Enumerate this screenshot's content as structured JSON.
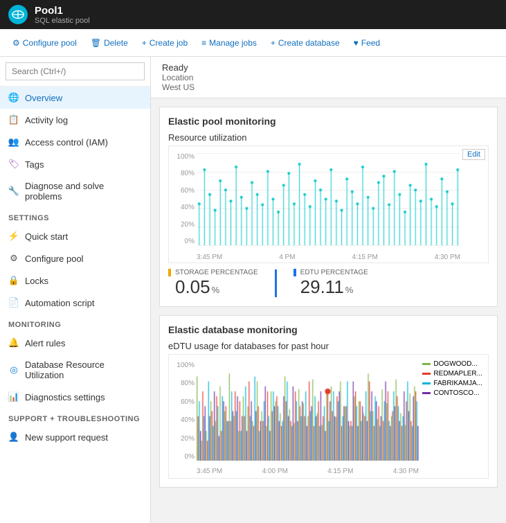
{
  "header": {
    "title": "Pool1",
    "subtitle": "SQL elastic pool",
    "icon_color": "#00b4d8"
  },
  "toolbar": {
    "buttons": [
      {
        "id": "configure-pool",
        "label": "Configure pool",
        "icon": "⚙"
      },
      {
        "id": "delete",
        "label": "Delete",
        "icon": "🗑"
      },
      {
        "id": "create-job",
        "label": "Create job",
        "icon": "+"
      },
      {
        "id": "manage-jobs",
        "label": "Manage jobs",
        "icon": "≡"
      },
      {
        "id": "create-database",
        "label": "Create database",
        "icon": "+"
      },
      {
        "id": "feed",
        "label": "Feed",
        "icon": "♥"
      }
    ]
  },
  "search": {
    "placeholder": "Search (Ctrl+/)"
  },
  "sidebar": {
    "nav_items": [
      {
        "id": "overview",
        "label": "Overview",
        "icon": "globe",
        "active": true
      },
      {
        "id": "activity-log",
        "label": "Activity log",
        "icon": "list"
      },
      {
        "id": "access-control",
        "label": "Access control (IAM)",
        "icon": "people"
      },
      {
        "id": "tags",
        "label": "Tags",
        "icon": "tag"
      },
      {
        "id": "diagnose",
        "label": "Diagnose and solve problems",
        "icon": "wrench"
      }
    ],
    "sections": [
      {
        "title": "SETTINGS",
        "items": [
          {
            "id": "quick-start",
            "label": "Quick start",
            "icon": "lightning"
          },
          {
            "id": "configure-pool",
            "label": "Configure pool",
            "icon": "gear"
          },
          {
            "id": "locks",
            "label": "Locks",
            "icon": "lock"
          },
          {
            "id": "automation-script",
            "label": "Automation script",
            "icon": "script"
          }
        ]
      },
      {
        "title": "MONITORING",
        "items": [
          {
            "id": "alert-rules",
            "label": "Alert rules",
            "icon": "alert"
          },
          {
            "id": "db-resource",
            "label": "Database Resource Utilization",
            "icon": "circle"
          },
          {
            "id": "diagnostics",
            "label": "Diagnostics settings",
            "icon": "chart"
          }
        ]
      },
      {
        "title": "SUPPORT + TROUBLESHOOTING",
        "items": [
          {
            "id": "new-support",
            "label": "New support request",
            "icon": "person"
          }
        ]
      }
    ]
  },
  "content": {
    "status": "Ready",
    "location_label": "Location",
    "location_value": "West US",
    "pool_monitoring": {
      "title": "Elastic pool monitoring",
      "chart_title": "Resource utilization",
      "edit_label": "Edit",
      "x_labels": [
        "3:45 PM",
        "4 PM",
        "4:15 PM",
        "4:30 PM"
      ],
      "y_labels": [
        "100%",
        "80%",
        "60%",
        "40%",
        "20%",
        "0%"
      ],
      "metrics": [
        {
          "id": "storage",
          "label": "STORAGE PERCENTAGE",
          "value": "0.05",
          "unit": "%",
          "color": "#f0a500"
        },
        {
          "id": "edtu",
          "label": "EDTU PERCENTAGE",
          "value": "29.11",
          "unit": "%",
          "color": "#1a73e8"
        }
      ],
      "bar_data": [
        45,
        82,
        55,
        38,
        70,
        60,
        48,
        85,
        52,
        40,
        68,
        55,
        44,
        80,
        50,
        36,
        65,
        78,
        45,
        88,
        55,
        42,
        70,
        60,
        50,
        82,
        48,
        38,
        72,
        58,
        45,
        85,
        52,
        40,
        68,
        75,
        44,
        80,
        55,
        36,
        65,
        60,
        48,
        88,
        50,
        42,
        72,
        58,
        45,
        82
      ]
    },
    "db_monitoring": {
      "title": "Elastic database monitoring",
      "chart_title": "eDTU usage for databases for past hour",
      "x_labels": [
        "3:45 PM",
        "4:00 PM",
        "4:15 PM",
        "4:30 PM"
      ],
      "y_labels": [
        "100%",
        "80%",
        "60%",
        "40%",
        "20%",
        "0%"
      ],
      "legend": [
        {
          "label": "DOGWOOD...",
          "color": "#7cb84a"
        },
        {
          "label": "REDMAPLER...",
          "color": "#e8392a"
        },
        {
          "label": "FABRIKAMJA...",
          "color": "#00b4d8"
        },
        {
          "label": "CONTOSCO...",
          "color": "#7030a0"
        }
      ]
    }
  },
  "icons": {
    "globe": "🌐",
    "list": "📋",
    "people": "👥",
    "tag": "🏷",
    "wrench": "🔧",
    "lightning": "⚡",
    "gear": "⚙",
    "lock": "🔒",
    "script": "📄",
    "alert": "🔔",
    "circle": "◎",
    "chart": "📊",
    "person": "👤"
  }
}
